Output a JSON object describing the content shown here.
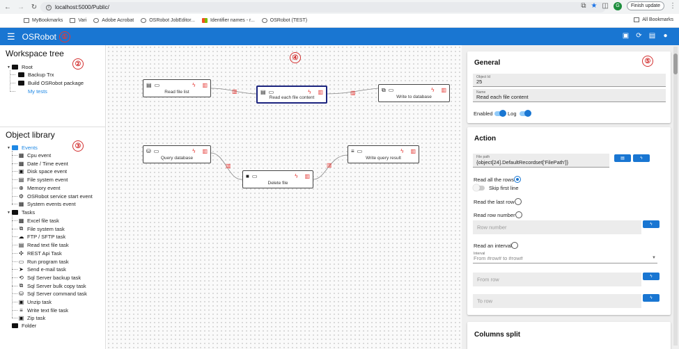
{
  "browser": {
    "url": "localhost:5000/Public/",
    "finish_update": "Finish update",
    "profile_initial": "G",
    "bookmarks": [
      "MyBookmarks",
      "Vari",
      "Adobe Acrobat",
      "OSRobot JobEditor...",
      "Identifier names - r...",
      "OSRobot (TEST)"
    ],
    "all_bookmarks": "All Bookmarks"
  },
  "app": {
    "title": "OSRobot"
  },
  "markers": [
    "①",
    "②",
    "③",
    "④",
    "⑤"
  ],
  "workspace": {
    "title": "Workspace tree",
    "root": "Root",
    "items": [
      "Backup Trx",
      "Build OSRobot package",
      "My tests"
    ]
  },
  "library": {
    "title": "Object library",
    "events_label": "Events",
    "events": [
      "Cpu event",
      "Date / Time event",
      "Disk space event",
      "File system event",
      "Memory event",
      "OSRobot service start event",
      "System events event"
    ],
    "tasks_label": "Tasks",
    "tasks": [
      "Excel file task",
      "File system task",
      "FTP / SFTP task",
      "Read text file task",
      "REST Api Task",
      "Run program task",
      "Send e-mail task",
      "Sql Server backup task",
      "Sql Server bulk copy task",
      "Sql Server command task",
      "Unzip task",
      "Write text file task",
      "Zip task"
    ],
    "folder_label": "Folder"
  },
  "nodes": [
    "Read file list",
    "Read each file content",
    "Write to database",
    "Query database",
    "Write query result",
    "Delete file"
  ],
  "general": {
    "title": "General",
    "object_id_label": "Object Id",
    "object_id": "25",
    "name_label": "Name",
    "name": "Read each file content",
    "enabled_label": "Enabled",
    "log_label": "Log"
  },
  "action": {
    "title": "Action",
    "file_path_label": "File path",
    "file_path": "{object[24].DefaultRecordset['FilePath']}",
    "read_all_rows": "Read all the rows",
    "skip_first_line": "Skip first line",
    "read_last_row": "Read the last row",
    "read_row_number": "Read row number",
    "row_number_ph": "Row number",
    "read_interval": "Read an interval",
    "interval_label": "Interval",
    "interval_value": "From #row# to #row#",
    "from_row_ph": "From row",
    "to_row_ph": "To row"
  },
  "columns_split": {
    "title": "Columns split"
  }
}
